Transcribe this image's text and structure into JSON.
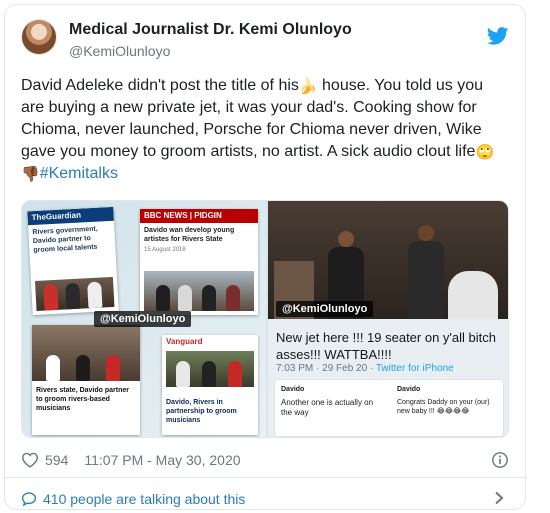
{
  "tweet": {
    "author": {
      "display_name": "Medical Journalist Dr. Kemi Olunloyo",
      "handle": "@KemiOlunloyo",
      "avatar_icon": "profile-photo"
    },
    "brand_icon": "twitter-bird-icon",
    "text": {
      "part1": "David Adeleke didn't post the title of his",
      "emoji1": "🍌",
      "part2": " house. You told us you are buying a new private jet, it was your dad's. Cooking show for Chioma, never launched, Porsche for Chioma never driven, Wike gave you money to groom artists, no artist. A sick audio clout life",
      "emoji2": "🙄",
      "emoji3": "👎🏾",
      "hashtag": "#Kemitalks"
    },
    "media": {
      "left": {
        "clip1_head": "TheGuardian",
        "clip1_body": "Rivers government, Davido partner to groom local talents",
        "clip2_head": "BBC NEWS | PIDGIN",
        "clip2_body": "Davido wan develop young artistes for Rivers State",
        "clip2_date": "15 August 2018",
        "clip3_body": "Rivers state, Davido partner to groom rivers-based musicians",
        "clip4_head": "Vanguard",
        "clip4_body": "Davido, Rivers in partnership to groom musicians",
        "watermark": "@KemiOlunloyo"
      },
      "right": {
        "quote_text": "New jet here !!! 19 seater on y'all bitch asses!!! WATTBA!!!!",
        "quote_time": "7:03 PM · 29 Feb 20 · ",
        "quote_source": "Twitter for iPhone",
        "ig_user1": "Davido",
        "ig_text1": "Another one is actually on the way",
        "ig_user2": "Davido",
        "ig_text2": "Congrats Daddy on your (our) new baby !!! 😂😂😂😂",
        "watermark": "@KemiOlunloyo"
      }
    },
    "likes": "594",
    "timestamp": "11:07 PM - May 30, 2020",
    "conversation": "410 people are talking about this"
  },
  "colors": {
    "link": "#2b7bb9",
    "brand": "#1da1f2",
    "muted": "#697882",
    "border": "#e1e8ed"
  }
}
